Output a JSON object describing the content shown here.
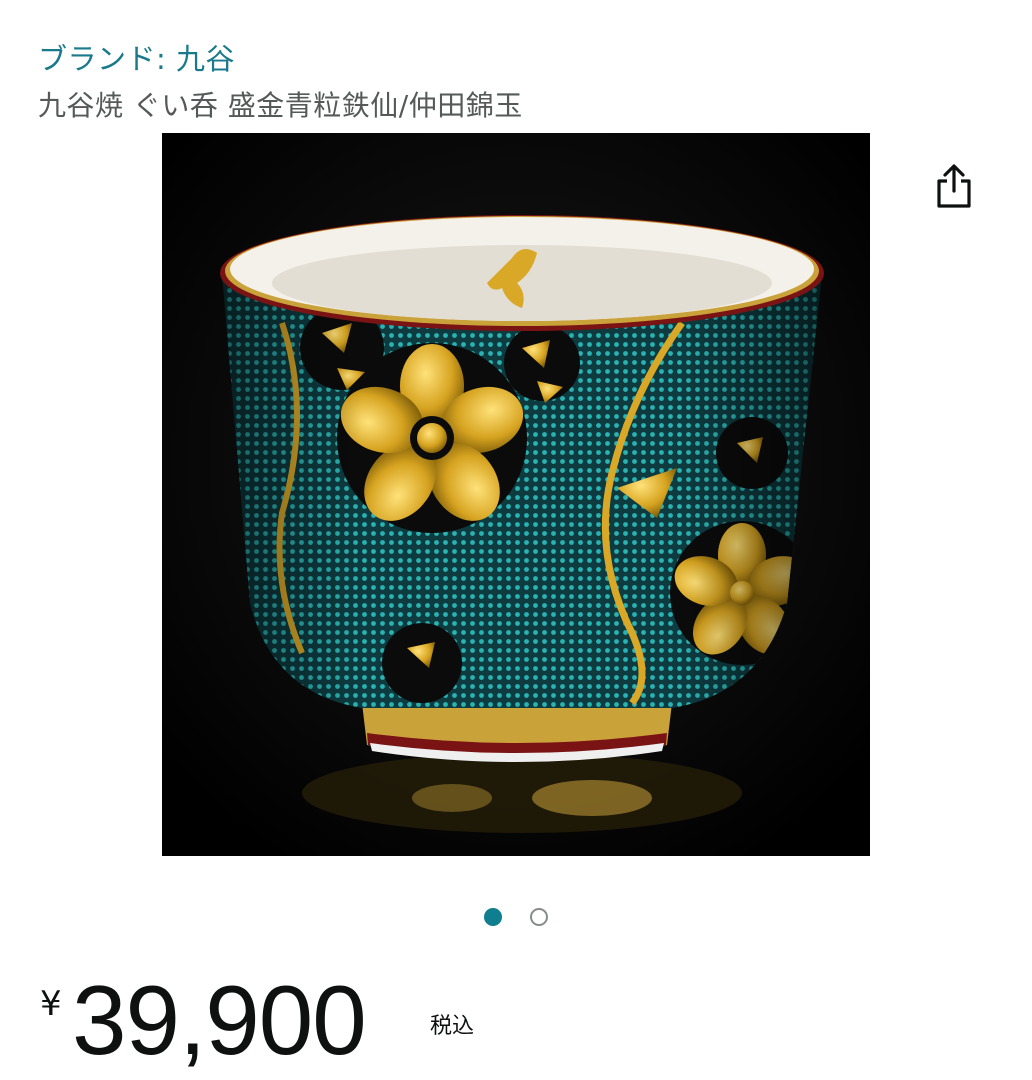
{
  "brand": {
    "text": "ブランド: 九谷"
  },
  "product": {
    "title": "九谷焼 ぐい呑 盛金青粒鉄仙/仲田錦玉"
  },
  "share": {
    "icon": "share-icon"
  },
  "gallery": {
    "image_count": 2,
    "active_index": 0,
    "active_color": "#0f7f8f"
  },
  "price": {
    "symbol": "¥",
    "amount": "39,900",
    "tax_note": "税込"
  },
  "colors": {
    "link": "#1a7a8c",
    "text_muted": "#565959"
  }
}
